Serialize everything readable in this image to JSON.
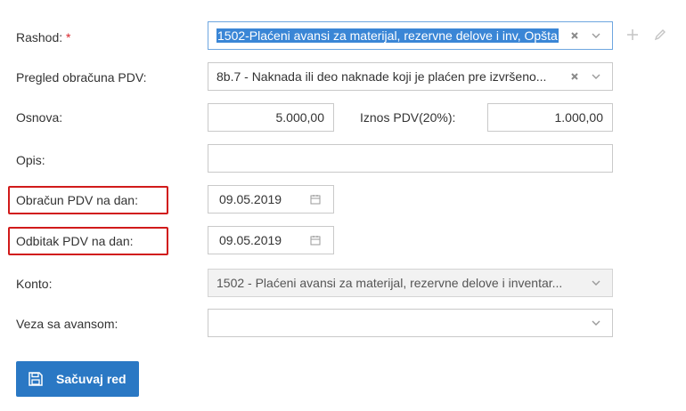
{
  "form": {
    "rashod": {
      "label": "Rashod:",
      "required_mark": "*",
      "value": "1502-Plaćeni avansi za materijal, rezervne delove i inv, Opšta"
    },
    "pregled": {
      "label": "Pregled obračuna PDV:",
      "value": "8b.7 - Naknada ili deo naknade koji je plaćen pre izvršeno..."
    },
    "osnova": {
      "label": "Osnova:",
      "value": "5.000,00"
    },
    "iznos_pdv": {
      "label": "Iznos PDV(20%):",
      "value": "1.000,00"
    },
    "opis": {
      "label": "Opis:",
      "value": ""
    },
    "obracun": {
      "label": "Obračun PDV na dan:",
      "value": "09.05.2019"
    },
    "odbitak": {
      "label": "Odbitak PDV na dan:",
      "value": "09.05.2019"
    },
    "konto": {
      "label": "Konto:",
      "value": "1502 - Plaćeni avansi za materijal, rezervne delove i inventar..."
    },
    "veza": {
      "label": "Veza sa avansom:",
      "value": ""
    }
  },
  "actions": {
    "save_label": "Sačuvaj red"
  },
  "colors": {
    "accent": "#2a78c4",
    "highlight_border": "#d11a1a",
    "required": "#d9262c",
    "selection": "#3a86d6"
  },
  "icons": [
    "clear-icon",
    "chevron-down-icon",
    "plus-icon",
    "pencil-icon",
    "calendar-icon",
    "save-icon"
  ]
}
